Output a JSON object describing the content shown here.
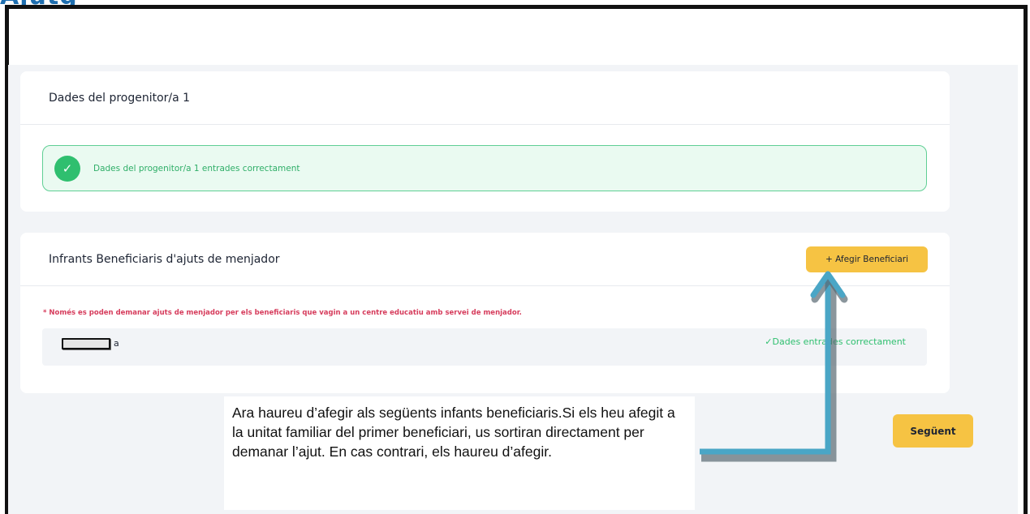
{
  "page": {
    "top_fragment": "Ajutg"
  },
  "card1": {
    "title": "Dades del progenitor/a 1",
    "success_message": "Dades del progenitor/a 1 entrades correctament",
    "check_icon": "check-circle-icon"
  },
  "card2": {
    "title": "Infrants Beneficiaris d'ajuts de menjador",
    "add_button_label": "+ Afegir Beneficiari",
    "note": "* Només es poden demanar ajuts de menjador per els beneficiaris que vagin a un centre educatiu amb servei de menjador.",
    "child": {
      "name_suffix": "a",
      "status": "✓Dades entrades correctament"
    }
  },
  "footer": {
    "next_label": "Següent"
  },
  "callout": {
    "text": "Ara haureu d’afegir als següents infants beneficiaris.Si els heu afegit a la unitat familiar del primer beneficiari, us sortiran directament per demanar l’ajut. En cas contrari, els haureu d’afegir."
  },
  "colors": {
    "accent_yellow": "#f6c343",
    "success_green": "#2fbf6f",
    "warning_red": "#d63c5c",
    "arrow_blue": "#4aa6c6"
  }
}
